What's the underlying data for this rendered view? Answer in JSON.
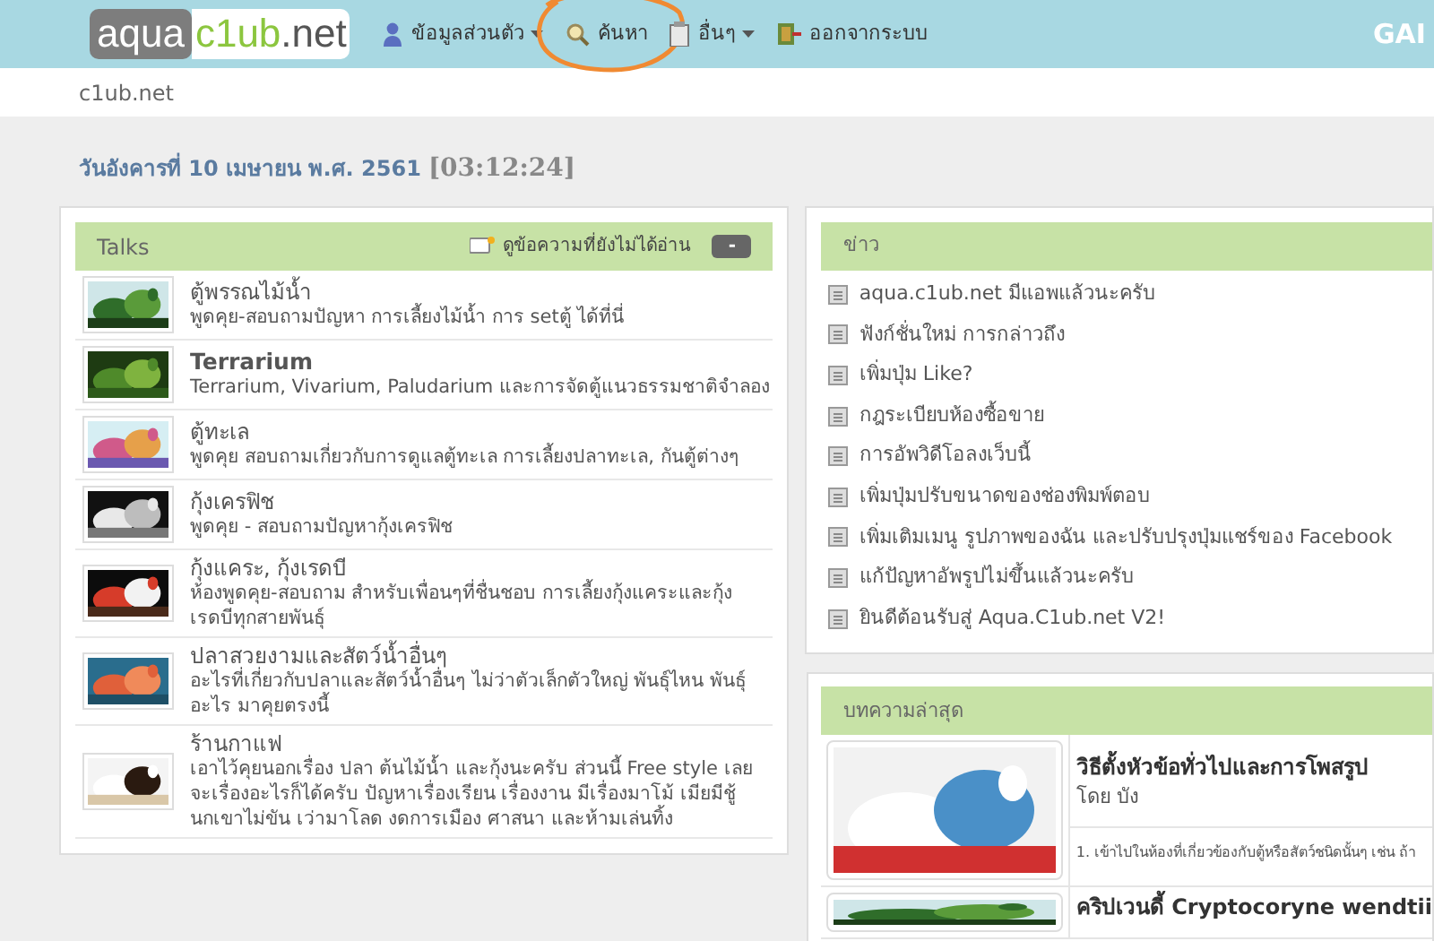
{
  "header": {
    "logo": {
      "part_1": "aqua",
      "part_2": "c1ub",
      ".net": ".net"
    },
    "menu": [
      {
        "label": "ข้อมูลส่วนตัว",
        "dropdown": true,
        "highlighted": false
      },
      {
        "label": "ค้นหา",
        "dropdown": false,
        "highlighted": true
      },
      {
        "label": "อื่นๆ",
        "dropdown": true,
        "highlighted": false
      },
      {
        "label": "ออกจากระบบ",
        "dropdown": false,
        "highlighted": false
      }
    ],
    "right_text": "GAI"
  },
  "breadcrumb": "c1ub.net",
  "date": {
    "text": "วันอังคารที่ 10 เมษายน พ.ศ. 2561",
    "time": "[03:12:24]"
  },
  "talks": {
    "title": "Talks",
    "unread_link": "ดูข้อความที่ยังไม่ได้อ่าน",
    "collapse": "-",
    "forums": [
      {
        "title": "ตู้พรรณไม้น้ำ",
        "bold": false,
        "description": "พูดคุย-สอบถามปัญหา การเลี้ยงไม้น้ำ การ setตู้ ได้ที่นี่"
      },
      {
        "title": "Terrarium",
        "bold": true,
        "description": "Terrarium, Vivarium, Paludarium และการจัดตู้แนวธรรมชาติจำลอง"
      },
      {
        "title": "ตู้ทะเล",
        "bold": false,
        "description": "พูดคุย สอบถามเกี่ยวกับการดูแลตู้ทะเล การเลี้ยงปลาทะเล, กันตู้ต่างๆ"
      },
      {
        "title": "กุ้งเครฟิช",
        "bold": false,
        "description": "พูดคุย - สอบถามปัญหากุ้งเครฟิช"
      },
      {
        "title": "กุ้งแคระ, กุ้งเรดบี",
        "bold": false,
        "description": "ห้องพูดคุย-สอบถาม สำหรับเพื่อนๆที่ชื่นชอบ การเลี้ยงกุ้งแคระและกุ้งเรดบีทุกสายพันธุ์"
      },
      {
        "title": "ปลาสวยงามและสัตว์น้ำอื่นๆ",
        "bold": false,
        "description": "อะไรที่เกี่ยวกับปลาและสัตว์น้ำอื่นๆ ไม่ว่าตัวเล็กตัวใหญ่ พันธุ์ไหน พันธุ์อะไร มาคุยตรงนี้"
      },
      {
        "title": "ร้านกาแฟ",
        "bold": false,
        "description": "เอาไว้คุยนอกเรื่อง ปลา ต้นไม้น้ำ และกุ้งนะครับ ส่วนนี้ Free style เลย จะเรื่องอะไรก็ได้ครับ ปัญหาเรื่องเรียน เรื่องงาน มีเรื่องมาโม้ เมียมีชู้ นกเขาไม่ขัน เว่ามาโลด งดการเมือง ศาสนา และห้ามเล่นทิ้ง"
      }
    ]
  },
  "news": {
    "title": "ข่าว",
    "items": [
      "aqua.c1ub.net มีแอพแล้วนะครับ",
      "ฟังก์ชั่นใหม่ การกล่าวถึง",
      "เพิ่มปุ่ม Like?",
      "กฎระเบียบห้องซื้อขาย",
      "การอัพวิดีโอลงเว็บนี้",
      "เพิ่มปุ่มปรับขนาดของช่องพิมพ์ตอบ",
      "เพิ่มเติมเมนู รูปภาพของฉัน และปรับปรุงปุ่มแชร์ของ Facebook",
      "แก้ปัญหาอัพรูปไม่ขึ้นแล้วนะครับ",
      "ยินดีต้อนรับสู่ Aqua.C1ub.net V2!"
    ]
  },
  "articles": {
    "title": "บทความล่าสุด",
    "items": [
      {
        "title": "วิธีตั้งหัวข้อทั่วไปและการโพสรูป",
        "author": "โดย บัง",
        "excerpt": "1. เข้าไปในห้องที่เกี่ยวข้องกับตู้หรือสัตว์ชนิดนั้นๆ เช่น ถ้า"
      },
      {
        "title": "คริปเวนดี้ Cryptocoryne wendtii"
      }
    ]
  }
}
